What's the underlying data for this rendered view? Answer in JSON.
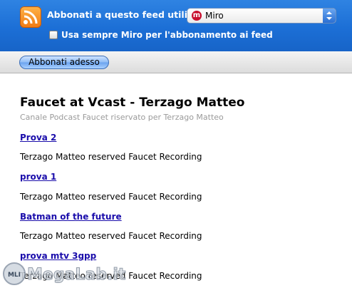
{
  "header": {
    "subscribe_label": "Abbonati a questo feed utilizzando",
    "reader": "Miro",
    "reader_logo_letter": "m",
    "always_use_label": "Usa sempre Miro per l'abbonamento ai feed",
    "always_use_checked": false
  },
  "toolbar": {
    "subscribe_button": "Abbonati adesso"
  },
  "feed": {
    "title": "Faucet at Vcast - Terzago Matteo",
    "subtitle": "Canale Podcast Faucet riservato per Terzago Matteo",
    "items": [
      {
        "title": "Prova 2",
        "description": "Terzago Matteo reserved Faucet Recording"
      },
      {
        "title": "prova 1",
        "description": "Terzago Matteo reserved Faucet Recording"
      },
      {
        "title": "Batman of the future",
        "description": "Terzago Matteo reserved Faucet Recording"
      },
      {
        "title": "prova mtv 3gpp",
        "description": "Terzago Matteo reserved Faucet Recording"
      }
    ]
  },
  "watermark": {
    "text": "MegaLab.it",
    "badge": "MLI"
  },
  "colors": {
    "header_blue": "#1c6fd6",
    "link_blue": "#1a0dab",
    "rss_orange": "#f07a14",
    "miro_red": "#c8102e"
  }
}
